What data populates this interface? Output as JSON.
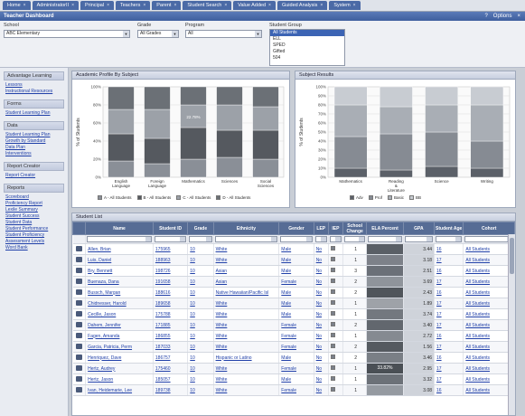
{
  "tabs": [
    {
      "label": "Home"
    },
    {
      "label": "AdministratorII"
    },
    {
      "label": "Principal"
    },
    {
      "label": "Teachers"
    },
    {
      "label": "Parent"
    },
    {
      "label": "Student Search"
    },
    {
      "label": "Value Added"
    },
    {
      "label": "Guided Analysis"
    },
    {
      "label": "System"
    }
  ],
  "title": "Teacher Dashboard",
  "title_right": {
    "help": "?",
    "options": "Options"
  },
  "filters": {
    "school_label": "School",
    "school_value": "ABC Elementary",
    "grade_label": "Grade",
    "grade_value": "All Grades",
    "program_label": "Program",
    "program_value": "All",
    "group_label": "Student Group",
    "group_options": [
      "All Students",
      "ELL",
      "SPED",
      "Gifted",
      "504"
    ],
    "group_selected": 0
  },
  "sidebar": [
    {
      "head": "Advantage Learning",
      "links": [
        "Lessons",
        "Instructional Resources"
      ]
    },
    {
      "head": "Forms",
      "links": [
        "Student Learning Plan"
      ]
    },
    {
      "head": "Data",
      "links": [
        "Student Learning Plan",
        "Growth by Standard",
        "Data Plan",
        "Interventions"
      ]
    },
    {
      "head": "Report Creator",
      "links": [
        "Report Creator"
      ]
    },
    {
      "head": "Reports",
      "links": [
        "Scoreboard",
        "Proficiency Report",
        "Lexile Summary",
        "Student Success",
        "Student Data",
        "Student Performance",
        "Student Proficiency",
        "Assessment Levels",
        "Word Bank"
      ]
    }
  ],
  "chart_left": {
    "title": "Academic Profile By Subject",
    "legend": [
      "A - All Students",
      "B - All Students",
      "C - All Students",
      "D - All Students"
    ]
  },
  "chart_right": {
    "title": "Subject Results",
    "legend": [
      "Adv",
      "Prof",
      "Basic",
      "BB"
    ]
  },
  "chart_data": [
    {
      "type": "bar",
      "title": "Academic Profile By Subject",
      "ylabel": "% of Students",
      "ylim": [
        0,
        100
      ],
      "yticks": [
        "0%",
        "20%",
        "40%",
        "60%",
        "80%",
        "100%"
      ],
      "categories": [
        "English Language",
        "Foreign Language",
        "Mathematics",
        "Sciences",
        "Social Sciences"
      ],
      "series": [
        {
          "name": "Level 4",
          "color": "#8a8f97",
          "values": [
            18,
            15,
            20,
            22,
            20
          ]
        },
        {
          "name": "Level 3",
          "color": "#55595f",
          "values": [
            30,
            28,
            35,
            30,
            32
          ]
        },
        {
          "name": "Level 2",
          "color": "#9ca1a8",
          "values": [
            27,
            32,
            25,
            28,
            26
          ]
        },
        {
          "name": "Level 1",
          "color": "#6b7076",
          "values": [
            25,
            25,
            20,
            20,
            22
          ]
        }
      ],
      "labels": [
        [
          "",
          "",
          "22.78%",
          "",
          ""
        ],
        [
          "",
          "",
          "",
          "",
          ""
        ]
      ]
    },
    {
      "type": "bar",
      "title": "Subject Results",
      "ylabel": "% of Students",
      "ylim": [
        0,
        100
      ],
      "yticks": [
        "0%",
        "10%",
        "20%",
        "30%",
        "40%",
        "50%",
        "60%",
        "70%",
        "80%",
        "90%",
        "100%"
      ],
      "categories": [
        "Mathematics",
        "Reading & Literature",
        "Science",
        "Writing"
      ],
      "series": [
        {
          "name": "Adv",
          "color": "#5b6068",
          "values": [
            10,
            8,
            12,
            10
          ]
        },
        {
          "name": "Prof",
          "color": "#868b93",
          "values": [
            35,
            40,
            38,
            30
          ]
        },
        {
          "name": "Basic",
          "color": "#a9aeb5",
          "values": [
            35,
            30,
            30,
            40
          ]
        },
        {
          "name": "BB",
          "color": "#c8ccd2",
          "values": [
            20,
            22,
            20,
            20
          ]
        }
      ]
    }
  ],
  "table": {
    "title": "Student List",
    "headers": [
      "",
      "Name",
      "Student ID",
      "Grade",
      "Ethnicity",
      "Gender",
      "LEP",
      "IEP",
      "School Change",
      "ELA Percent",
      "GPA",
      "Student Age",
      "Cohort"
    ],
    "rows": [
      [
        "Allen, Brian",
        "175965",
        "10",
        "White",
        "Male",
        "No",
        "",
        "1",
        "",
        "3.44",
        "16",
        "All Students"
      ],
      [
        "Luis, Daniel",
        "188963",
        "10",
        "White",
        "Male",
        "No",
        "",
        "1",
        "",
        "3.18",
        "17",
        "All Students"
      ],
      [
        "Bry, Bennett",
        "198726",
        "10",
        "Asian",
        "Male",
        "No",
        "",
        "3",
        "",
        "2.51",
        "16",
        "All Students"
      ],
      [
        "Buenaza, Dana",
        "191658",
        "10",
        "Asian",
        "Female",
        "No",
        "",
        "2",
        "",
        "3.69",
        "17",
        "All Students"
      ],
      [
        "Bussch, Margan",
        "188616",
        "10",
        "Native Hawaiian/Pacific Isl",
        "Male",
        "No",
        "",
        "2",
        "",
        "2.43",
        "16",
        "All Students"
      ],
      [
        "Chidnesser, Harold",
        "189658",
        "10",
        "White",
        "Male",
        "No",
        "",
        "1",
        "",
        "1.89",
        "17",
        "All Students"
      ],
      [
        "Cecille, Jason",
        "175788",
        "10",
        "White",
        "Male",
        "No",
        "",
        "1",
        "",
        "3.74",
        "17",
        "All Students"
      ],
      [
        "Dahem, Jennifer",
        "171885",
        "10",
        "White",
        "Female",
        "No",
        "",
        "2",
        "",
        "3.40",
        "17",
        "All Students"
      ],
      [
        "Fagen, Amanda",
        "186855",
        "10",
        "White",
        "Female",
        "No",
        "",
        "1",
        "",
        "2.72",
        "16",
        "All Students"
      ],
      [
        "Garcia, Patricia, Perm",
        "187033",
        "10",
        "White",
        "Female",
        "No",
        "",
        "2",
        "",
        "1.56",
        "17",
        "All Students"
      ],
      [
        "Henriquez, Dave",
        "186757",
        "10",
        "Hispanic or Latino",
        "Male",
        "No",
        "",
        "2",
        "",
        "3.46",
        "16",
        "All Students"
      ],
      [
        "Hertz, Audrey",
        "175460",
        "10",
        "White",
        "Female",
        "No",
        "",
        "1",
        "33.82%",
        "2.95",
        "17",
        "All Students"
      ],
      [
        "Hertz, Jason",
        "185057",
        "10",
        "White",
        "Male",
        "No",
        "",
        "1",
        "",
        "3.32",
        "17",
        "All Students"
      ],
      [
        "Ivan, Heidemarie, Lee",
        "189738",
        "10",
        "White",
        "Female",
        "No",
        "",
        "1",
        "",
        "3.08",
        "16",
        "All Students"
      ]
    ],
    "heat_colors": [
      "#5a5f66",
      "#7d8189",
      "#6b7078",
      "#8f949b",
      "#50555b",
      "#9ea2a8",
      "#73787f",
      "#62676e",
      "#858a91",
      "#555a60",
      "#7a7f86",
      "#4a4f55",
      "#6c7178",
      "#959aa1"
    ]
  }
}
